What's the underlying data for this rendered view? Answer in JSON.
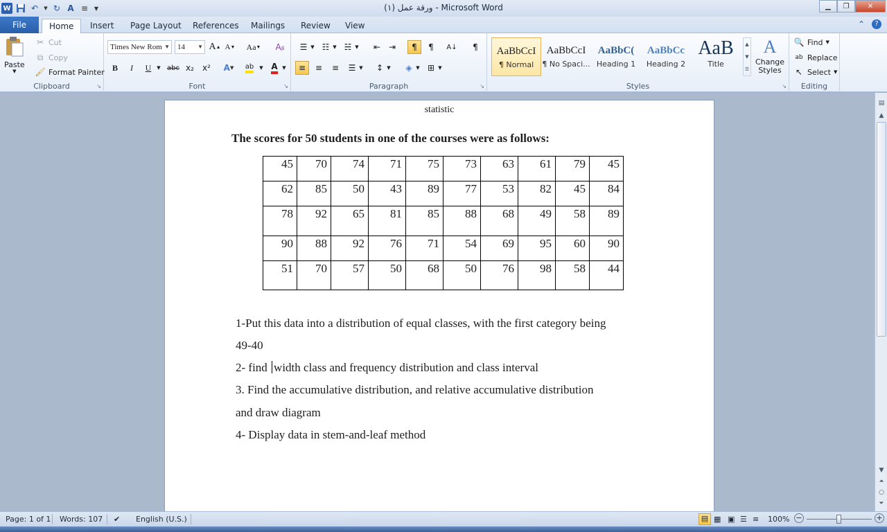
{
  "window": {
    "title": "ورقة عمل (١)  - Microsoft Word",
    "minimize_icon": "minimize-icon",
    "maximize_icon": "restore-icon",
    "close_icon": "close-icon"
  },
  "quick_access": [
    "word-logo",
    "save-icon",
    "undo-icon",
    "redo-icon",
    "spelling-icon",
    "justify-icon",
    "customize-icon"
  ],
  "tabs": {
    "file": "File",
    "items": [
      "Home",
      "Insert",
      "Page Layout",
      "References",
      "Mailings",
      "Review",
      "View"
    ],
    "active": "Home"
  },
  "ribbon": {
    "clipboard": {
      "label": "Clipboard",
      "paste": "Paste",
      "cut": "Cut",
      "copy": "Copy",
      "format_painter": "Format Painter"
    },
    "font": {
      "label": "Font",
      "font_name": "Times New Rom",
      "font_size": "14",
      "bold": "B",
      "italic": "I",
      "underline": "U",
      "strikethrough": "abc",
      "subscript": "x₂",
      "superscript": "x²",
      "grow": "A",
      "shrink": "A",
      "change_case": "Aa"
    },
    "paragraph": {
      "label": "Paragraph",
      "pilcrow": "¶"
    },
    "styles": {
      "label": "Styles",
      "items": [
        {
          "sample": "AaBbCcI",
          "name": "¶ Normal"
        },
        {
          "sample": "AaBbCcI",
          "name": "¶ No Spaci..."
        },
        {
          "sample": "AaBbC(",
          "name": "Heading 1"
        },
        {
          "sample": "AaBbCc",
          "name": "Heading 2"
        },
        {
          "sample": "AaB",
          "name": "Title"
        }
      ],
      "selected": "¶ Normal",
      "change_styles": "Change Styles"
    },
    "editing": {
      "label": "Editing",
      "find": "Find",
      "replace": "Replace",
      "select": "Select"
    }
  },
  "document": {
    "header": "statistic",
    "heading": "The scores for 50 students in one of the courses were as follows:",
    "table": [
      [
        "45",
        "70",
        "74",
        "71",
        "75",
        "73",
        "63",
        "61",
        "79",
        "45"
      ],
      [
        "62",
        "85",
        "50",
        "43",
        "89",
        "77",
        "53",
        "82",
        "45",
        "84"
      ],
      [
        "78",
        "92",
        "65",
        "81",
        "85",
        "88",
        "68",
        "49",
        "58",
        "89"
      ],
      [
        "90",
        "88",
        "92",
        "76",
        "71",
        "54",
        "69",
        "95",
        "60",
        "90"
      ],
      [
        "51",
        "70",
        "57",
        "50",
        "68",
        "50",
        "76",
        "98",
        "58",
        "44"
      ]
    ],
    "q1_line1": "1-Put this data into a distribution of equal classes, with the first category being",
    "q1_line2": "49-40",
    "q2_before": "2- find ",
    "q2_after": "width class and frequency distribution and class interval",
    "q3_line1": "3. Find the  accumulative distribution, and relative accumulative distribution",
    "q3_line2": "and draw diagram",
    "q4": "4-  Display data in stem-and-leaf method"
  },
  "status": {
    "page": "Page: 1 of 1",
    "words": "Words: 107",
    "language": "English (U.S.)",
    "zoom": "100%",
    "zoom_out": "−",
    "zoom_in": "+"
  }
}
